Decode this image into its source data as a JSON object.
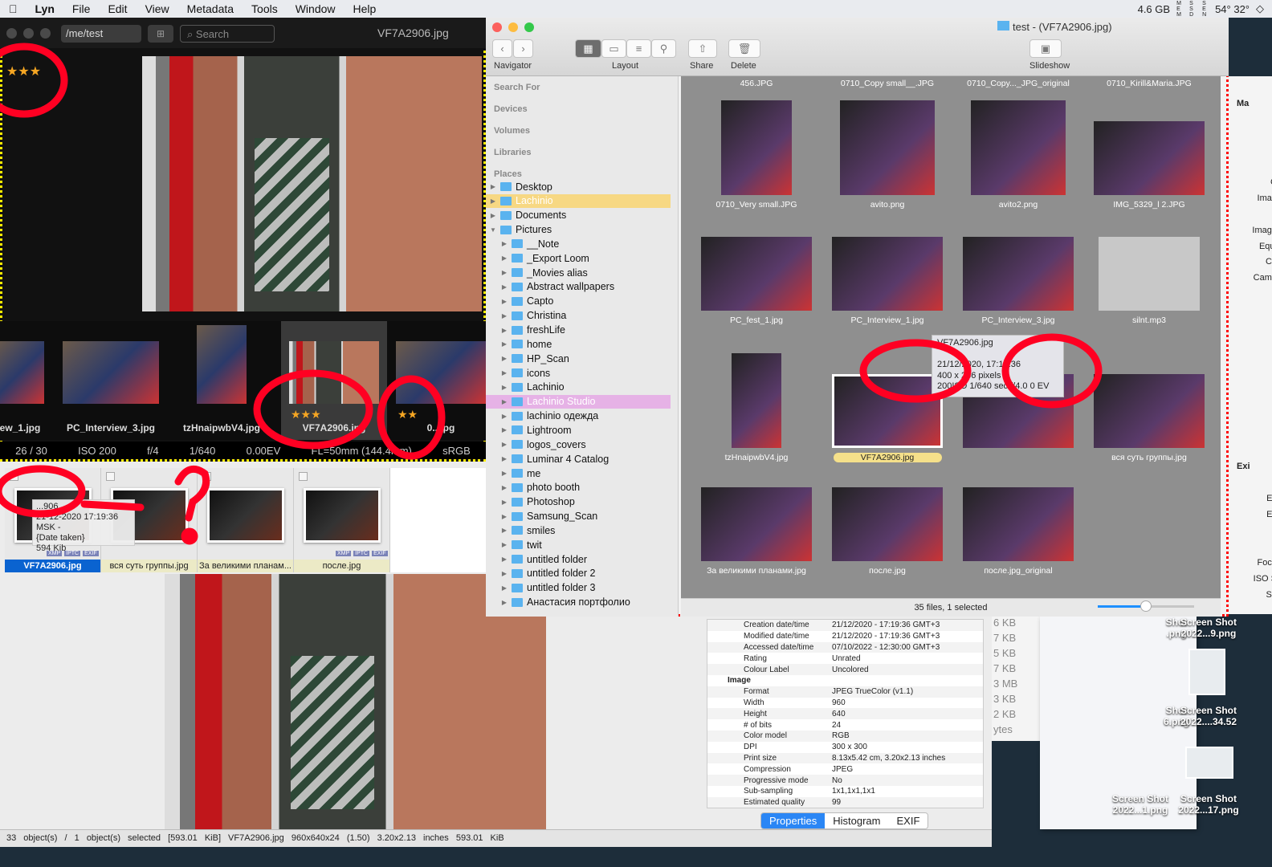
{
  "menubar": {
    "items": [
      "Lyn",
      "File",
      "Edit",
      "View",
      "Metadata",
      "Tools",
      "Window",
      "Help"
    ],
    "tray": {
      "memory": "4.6 GB",
      "mem_label": "MEM",
      "ssd_label": "SSD",
      "sensors_label": "SEN",
      "temps": "54° 32°"
    }
  },
  "viewer": {
    "path": "/me/test",
    "search_placeholder": "Search",
    "title": "VF7A2906.jpg",
    "rating": "★★★",
    "filmstrip": [
      {
        "label": "ew_1.jpg"
      },
      {
        "label": "PC_Interview_3.jpg"
      },
      {
        "label": "tzHnaipwbV4.jpg"
      },
      {
        "label": "VF7A2906.jpg",
        "stars": "★★★"
      },
      {
        "label": "0...jpg",
        "stars": "★★"
      }
    ],
    "info": [
      "26 / 30",
      "ISO 200",
      "f/4",
      "1/640",
      "0.00EV",
      "FL=50mm (144.4mm)",
      "sRGB"
    ]
  },
  "browser": {
    "thumbs": [
      {
        "label": "VF7A2906.jpg",
        "selected": true
      },
      {
        "label": "вся суть группы.jpg"
      },
      {
        "label": "За великими планам..."
      },
      {
        "label": "после.jpg"
      }
    ],
    "tooltip": {
      "name": "...906",
      "date": "21-12-2020 17:19:36 MSK -",
      "date_kind": "{Date taken}",
      "size": "594 Kib"
    },
    "badges": [
      "XMP",
      "IPTC",
      "EXIF"
    ],
    "status": "33 object(s) / 1 object(s) selected [593.01 KiB]   VF7A2906.jpg   960x640x24 (1.50)   3.20x2.13 inches   593.01 KiB",
    "properties": [
      {
        "k": "Creation date/time",
        "v": "21/12/2020 - 17:19:36 GMT+3"
      },
      {
        "k": "Modified date/time",
        "v": "21/12/2020 - 17:19:36 GMT+3"
      },
      {
        "k": "Accessed date/time",
        "v": "07/10/2022 - 12:30:00 GMT+3"
      },
      {
        "k": "Rating",
        "v": "Unrated"
      },
      {
        "k": "Colour Label",
        "v": "Uncolored"
      },
      {
        "k": "Image",
        "v": "",
        "section": true
      },
      {
        "k": "Format",
        "v": "JPEG TrueColor (v1.1)"
      },
      {
        "k": "Width",
        "v": "960"
      },
      {
        "k": "Height",
        "v": "640"
      },
      {
        "k": "# of bits",
        "v": "24"
      },
      {
        "k": "Color model",
        "v": "RGB"
      },
      {
        "k": "DPI",
        "v": "300 x 300"
      },
      {
        "k": "Print size",
        "v": "8.13x5.42 cm, 3.20x2.13 inches"
      },
      {
        "k": "Compression",
        "v": "JPEG"
      },
      {
        "k": "Progressive mode",
        "v": "No"
      },
      {
        "k": "Sub-sampling",
        "v": "1x1,1x1,1x1"
      },
      {
        "k": "Estimated quality",
        "v": "99"
      }
    ],
    "tabs": [
      "Properties",
      "Histogram",
      "EXIF"
    ]
  },
  "sizes": [
    "6 KB",
    "7 KB",
    "5 KB",
    "7 KB",
    "3 MB",
    "3 KB",
    "2 KB",
    "ytes"
  ],
  "desktop": [
    [
      "Shot",
      ".png"
    ],
    [
      "Screen Shot",
      "2022...9.png"
    ],
    [
      "Shot",
      "6.png"
    ],
    [
      "Screen Shot",
      "2022....34.52"
    ],
    [
      "Screen Shot",
      "2022...1.png"
    ],
    [
      "Screen Shot",
      "2022...17.png"
    ]
  ],
  "finder": {
    "title": "test - (VF7A2906.jpg)",
    "toolbar": {
      "navigator": "Navigator",
      "layout": "Layout",
      "share": "Share",
      "delete": "Delete",
      "slideshow": "Slideshow"
    },
    "sidebar": {
      "sections": [
        "Search For",
        "Devices",
        "Volumes",
        "Libraries",
        "Places"
      ],
      "items": [
        {
          "label": "Desktop",
          "lvl": 0,
          "open": false
        },
        {
          "label": "Lachinio",
          "lvl": 0,
          "hl": "y"
        },
        {
          "label": "Documents",
          "lvl": 0
        },
        {
          "label": "Pictures",
          "lvl": 0,
          "open": true
        },
        {
          "label": "__Note",
          "lvl": 1
        },
        {
          "label": "_Export Loom",
          "lvl": 1
        },
        {
          "label": "_Movies alias",
          "lvl": 1
        },
        {
          "label": "Abstract wallpapers",
          "lvl": 1
        },
        {
          "label": "Capto",
          "lvl": 1
        },
        {
          "label": "Christina",
          "lvl": 1
        },
        {
          "label": "freshLife",
          "lvl": 1
        },
        {
          "label": "home",
          "lvl": 1
        },
        {
          "label": "HP_Scan",
          "lvl": 1
        },
        {
          "label": "icons",
          "lvl": 1
        },
        {
          "label": "Lachinio",
          "lvl": 1
        },
        {
          "label": "Lachinio Studio",
          "lvl": 1,
          "hl": "p"
        },
        {
          "label": "lachinio одежда",
          "lvl": 1
        },
        {
          "label": "Lightroom",
          "lvl": 1
        },
        {
          "label": "logos_covers",
          "lvl": 1
        },
        {
          "label": "Luminar 4 Catalog",
          "lvl": 1
        },
        {
          "label": "me",
          "lvl": 1
        },
        {
          "label": "photo booth",
          "lvl": 1
        },
        {
          "label": "Photoshop",
          "lvl": 1
        },
        {
          "label": "Samsung_Scan",
          "lvl": 1
        },
        {
          "label": "smiles",
          "lvl": 1
        },
        {
          "label": "twit",
          "lvl": 1
        },
        {
          "label": "untitled folder",
          "lvl": 1
        },
        {
          "label": "untitled folder 2",
          "lvl": 1
        },
        {
          "label": "untitled folder 3",
          "lvl": 1
        },
        {
          "label": "Анастасия портфолио",
          "lvl": 1
        }
      ]
    },
    "grid": [
      {
        "label": "456.JPG",
        "row": 0
      },
      {
        "label": "0710_Copy small__.JPG",
        "row": 0
      },
      {
        "label": "0710_Copy..._JPG_original",
        "row": 0
      },
      {
        "label": "0710_Kirill&Maria.JPG",
        "row": 0
      },
      {
        "label": "0710_Very small.JPG",
        "row": 1,
        "w": 88,
        "h": 118
      },
      {
        "label": "avito.png",
        "row": 1,
        "w": 118,
        "h": 118
      },
      {
        "label": "avito2.png",
        "row": 1,
        "w": 118,
        "h": 118
      },
      {
        "label": "IMG_5329_l 2.JPG",
        "row": 1,
        "w": 138,
        "h": 92
      },
      {
        "label": "PC_fest_1.jpg",
        "row": 2,
        "w": 138,
        "h": 92
      },
      {
        "label": "PC_Interview_1.jpg",
        "row": 2,
        "w": 138,
        "h": 92
      },
      {
        "label": "PC_Interview_3.jpg",
        "row": 2,
        "w": 138,
        "h": 92
      },
      {
        "label": "silnt.mp3",
        "row": 2,
        "w": 126,
        "h": 92
      },
      {
        "label": "tzHnaipwbV4.jpg",
        "row": 3,
        "w": 62,
        "h": 118
      },
      {
        "label": "VF7A2906.jpg",
        "row": 3,
        "w": 138,
        "h": 92,
        "selected": true
      },
      {
        "label": "",
        "row": 3,
        "w": 138,
        "h": 92
      },
      {
        "label": "вся суть группы.jpg",
        "row": 3,
        "w": 138,
        "h": 92
      },
      {
        "label": "За великими планами.jpg",
        "row": 4,
        "w": 138,
        "h": 92
      },
      {
        "label": "после.jpg",
        "row": 4,
        "w": 138,
        "h": 92
      },
      {
        "label": "после.jpg_original",
        "row": 4,
        "w": 138,
        "h": 92
      }
    ],
    "tooltip": {
      "name": "VF7A2906.jpg",
      "date": "21/12/2020, 17:19:36",
      "size": "400 x 266 pixels",
      "exif": "200ISO 1/640 sec f/4.0 0 EV"
    },
    "status": "35 files, 1 selected",
    "zoom_fraction": 0.5
  },
  "right_panel": {
    "labels": [
      "Ma",
      "C",
      "Imag",
      "Image",
      "Equi",
      "Ca",
      "Came",
      "Exi",
      "Ex",
      "Ex",
      "F",
      "Foca",
      "ISO S",
      "Sh"
    ]
  },
  "colors": {
    "annotation": "#ff0000",
    "accent": "#2a86f5",
    "star": "#f5a623"
  }
}
